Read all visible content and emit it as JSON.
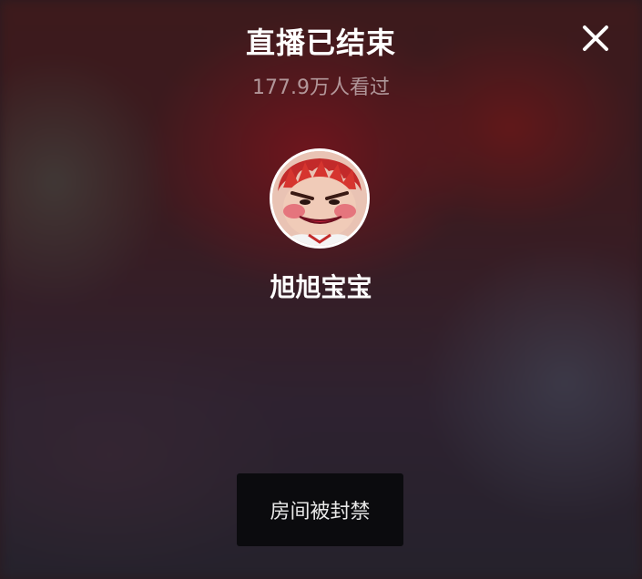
{
  "header": {
    "title": "直播已结束",
    "viewer_count": "177.9万人看过"
  },
  "close_icon": "close-icon",
  "streamer": {
    "name": "旭旭宝宝",
    "avatar_icon": "cartoon-avatar"
  },
  "status_button": {
    "label": "房间被封禁"
  },
  "colors": {
    "background_dark": "#2a1a1f",
    "background_red": "#78141c",
    "button_bg": "#0b0b0e",
    "text_primary": "#ffffff",
    "text_secondary": "#9a8c8f"
  }
}
